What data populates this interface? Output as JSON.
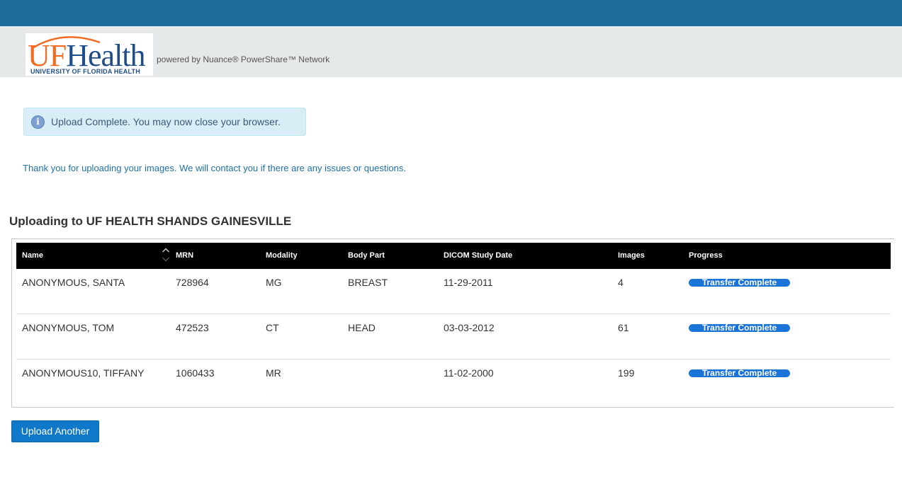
{
  "header": {
    "logo": {
      "uf": "UF",
      "health": "Health",
      "subtitle": "UNIVERSITY OF FLORIDA HEALTH"
    },
    "powered_by": "powered by Nuance® PowerShare™ Network"
  },
  "alert": {
    "icon": "info-icon",
    "text": "Upload Complete. You may now close your browser."
  },
  "thanks": "Thank you for uploading your images. We will contact you if there are any issues or questions.",
  "upload_heading": "Uploading to UF HEALTH SHANDS GAINESVILLE",
  "table": {
    "columns": [
      "Name",
      "MRN",
      "Modality",
      "Body Part",
      "DICOM Study Date",
      "Images",
      "Progress"
    ],
    "rows": [
      {
        "name": "ANONYMOUS, SANTA",
        "mrn": "728964",
        "modality": "MG",
        "body_part": "BREAST",
        "study_date": "11-29-2011",
        "images": "4",
        "progress": "Transfer Complete"
      },
      {
        "name": "ANONYMOUS, TOM",
        "mrn": "472523",
        "modality": "CT",
        "body_part": "HEAD",
        "study_date": "03-03-2012",
        "images": "61",
        "progress": "Transfer Complete"
      },
      {
        "name": "ANONYMOUS10, TIFFANY",
        "mrn": "1060433",
        "modality": "MR",
        "body_part": "",
        "study_date": "11-02-2000",
        "images": "199",
        "progress": "Transfer Complete"
      }
    ]
  },
  "upload_another": "Upload Another",
  "colors": {
    "topbar": "#1c6b98",
    "accent": "#0f78c8",
    "progress": "#1a74d8",
    "logo_orange": "#f26b21",
    "logo_blue": "#1f4d8a"
  }
}
